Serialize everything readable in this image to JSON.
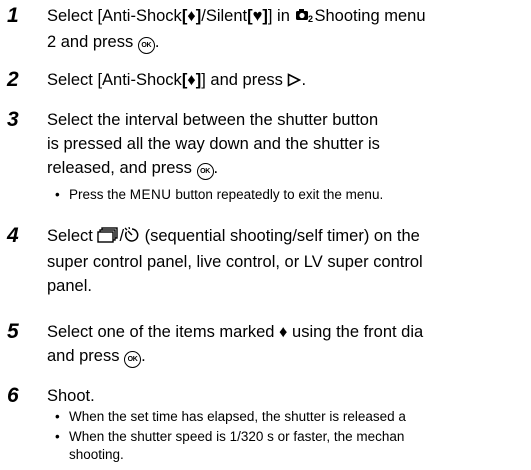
{
  "steps": [
    {
      "num": "1",
      "line1_a": "Select [Anti-Shock",
      "bracket_a": "[♦]",
      "line1_b": "/Silent",
      "bracket_b": "[♥]",
      "line1_c": "] in",
      "line1_d": "Shooting menu",
      "line2_a": "2 and press",
      "line2_b": "."
    },
    {
      "num": "2",
      "line1_a": "Select [Anti-Shock",
      "bracket": "[♦]",
      "line1_b": "] and press",
      "line1_c": "."
    },
    {
      "num": "3",
      "lines": [
        "Select the interval between the shutter button",
        "is pressed all the way down and the shutter is"
      ],
      "line3_a": "released, and press",
      "line3_b": ".",
      "bullet_a": "Press the",
      "bullet_menu": "MENU",
      "bullet_b": "button repeatedly to exit the menu."
    },
    {
      "num": "4",
      "line1_a": "Select",
      "line1_b": "(sequential shooting/self timer) on the",
      "lines": [
        "super control panel, live control, or LV super control",
        "panel."
      ]
    },
    {
      "num": "5",
      "line1": "Select one of the items marked ♦ using the front dia",
      "line2_a": "and press",
      "line2_b": "."
    },
    {
      "num": "6",
      "line1": "Shoot.",
      "bullets": [
        "When the set time has elapsed, the shutter is released a",
        "When the shutter speed is 1/320 s or faster, the mechan",
        "shooting."
      ]
    }
  ],
  "ok_label": "OK",
  "icons": [
    "shooting-menu-icon",
    "ok-button-icon",
    "right-arrow-icon",
    "sequential-shooting-icon",
    "self-timer-icon"
  ]
}
